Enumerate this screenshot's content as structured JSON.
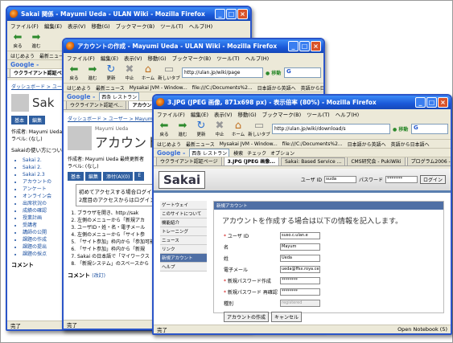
{
  "win1": {
    "title": "Sakai 関係 - Mayumi Ueda - ULAN Wiki - Mozilla Firefox",
    "menu": [
      "ファイル(F)",
      "編集(E)",
      "表示(V)",
      "移動(G)",
      "ブックマーク(B)",
      "ツール(T)",
      "ヘルプ(H)"
    ],
    "back": "戻る",
    "forward": "進む",
    "google_label": "Google -",
    "bookmarks": [
      "はじめよう",
      "最新ニュース"
    ],
    "tab": "ウクライアント認証ページ",
    "crumb": "ダッシュボード > ユーザー > Ma",
    "site_title": "Sak",
    "tabs": [
      "基本",
      "編集"
    ],
    "info": "作成者: Mayumi Ueda",
    "label": "ラベル: (なし)",
    "intro": "Sakaiの使い方につい",
    "links": [
      "Sakai 2.",
      "Sakai 2.",
      "Sakai 2.3",
      "アカウントの",
      "アンケート",
      "オンライン会",
      "出席状況の",
      "成績の確認",
      "授業計画",
      "受講者",
      "講師の公開",
      "課題の作成",
      "課題の提出",
      "課題の採点"
    ],
    "comment": "コメント",
    "status": "完了"
  },
  "win2": {
    "title": "アカウントの作成 - Mayumi Ueda - ULAN Wiki - Mozilla Firefox",
    "menu": [
      "ファイル(F)",
      "編集(E)",
      "表示(V)",
      "移動(G)",
      "ブックマーク(B)",
      "ツール(T)",
      "ヘルプ(H)"
    ],
    "nav": [
      "戻る",
      "進む",
      "更新",
      "中止",
      "ホーム",
      "新しいタブ"
    ],
    "url": "http://ulan.jp/wiki/page",
    "go": "移動",
    "bookmarks": [
      "はじめよう",
      "最新ニュース",
      "Mysakai JVM - Window...",
      "file:///C:/Documents%2...",
      "日本語から英語へ",
      "英語から日本語へ"
    ],
    "google_label": "Google -",
    "google_val": "西条 レストラン",
    "tabs": [
      "ウクライアント認証ペ...",
      "アカウント"
    ],
    "crumb": "ダッシュボード > ユーザー > Mayum",
    "author_small": "Mayumi Ueda",
    "page_title": "アカウントの",
    "info": "作成者: Mayumi Ueda 最終更新者",
    "label": "ラベル: (なし)",
    "sakai_tabs": [
      "基本",
      "編集",
      "添付(A)(0)",
      "E"
    ],
    "notice": "初めてアクセスする場合ログイン\n2度目のアクセスからはログイン",
    "steps": [
      "ブラウザを開き、http://sak",
      "左側のメニューから「新規アカ",
      "ユーザID・姓・名・電子メール",
      "左側のメニューから「サイト参",
      "「サイト参加」枠内から「参加可能",
      "「サイト参加」枠内から「新規",
      "Sakai の日本語で「マイワークス",
      "「新規システム」のスペースから"
    ],
    "comment": "コメント",
    "comment_hint": "(改訂)",
    "status": "完了"
  },
  "win3": {
    "title": "3.JPG (JPEG 画像, 871x698 px) - 表示倍率 (80%) - Mozilla Firefox",
    "menu": [
      "ファイル(F)",
      "編集(E)",
      "表示(V)",
      "移動(G)",
      "ブックマーク(B)",
      "ツール(T)",
      "ヘルプ(H)"
    ],
    "nav": [
      "戻る",
      "進む",
      "更新",
      "中止",
      "ホーム",
      "新しいタブ"
    ],
    "url": "http://ulan.jp/wiki/download/s",
    "go": "移動",
    "bookmarks": [
      "はじめよう",
      "最新ニュース",
      "Mysakai JVM - Window...",
      "file:///C:/Documents%2...",
      "日本語から英語へ",
      "英語から日本語へ"
    ],
    "google_label": "Google -",
    "google_val": "西条 レストラン",
    "google_tools": [
      "検索",
      "チェック",
      "オプション"
    ],
    "tabs": [
      "ウクライアント認証ページ",
      "3.JPG (JPEG 画像...",
      "Sakai: Based Service ...",
      "CMS研究会 - PukiWiki",
      "プログラム2006 - 平成..."
    ],
    "sakai_logo": "Sakai",
    "login_user_label": "ユーザ ID",
    "login_user": "suda",
    "login_pass_label": "パスワード",
    "login_pass": "*******",
    "login_btn": "ログイン",
    "leftnav": [
      "ゲートウェイ",
      "このサイトについて",
      "機能紹介",
      "トレーニング",
      "ニュース",
      "リンク",
      "新規アカウント",
      "ヘルプ"
    ],
    "form_header": "新規アカウント",
    "form_title": "アカウントを作成する場合は以下の情報を記入します。",
    "fields": [
      {
        "label": "ユーザ ID",
        "value": "suso.c.ulan.e",
        "required": true
      },
      {
        "label": "名",
        "value": "Mayum",
        "required": false
      },
      {
        "label": "姓",
        "value": "Ueda",
        "required": false
      },
      {
        "label": "電子メール",
        "value": "ueda@ffsx.roya.ce.a.a",
        "required": false
      },
      {
        "label": "新規パスワード作成",
        "value": "********",
        "required": true
      },
      {
        "label": "新規パスワード 再確認",
        "value": "********",
        "required": true
      },
      {
        "label": "種別",
        "value": "registered",
        "required": false
      }
    ],
    "btn_create": "アカウントの作成",
    "btn_cancel": "キャンセル",
    "status": "完了",
    "status_right": "Open Notebook (5)"
  }
}
